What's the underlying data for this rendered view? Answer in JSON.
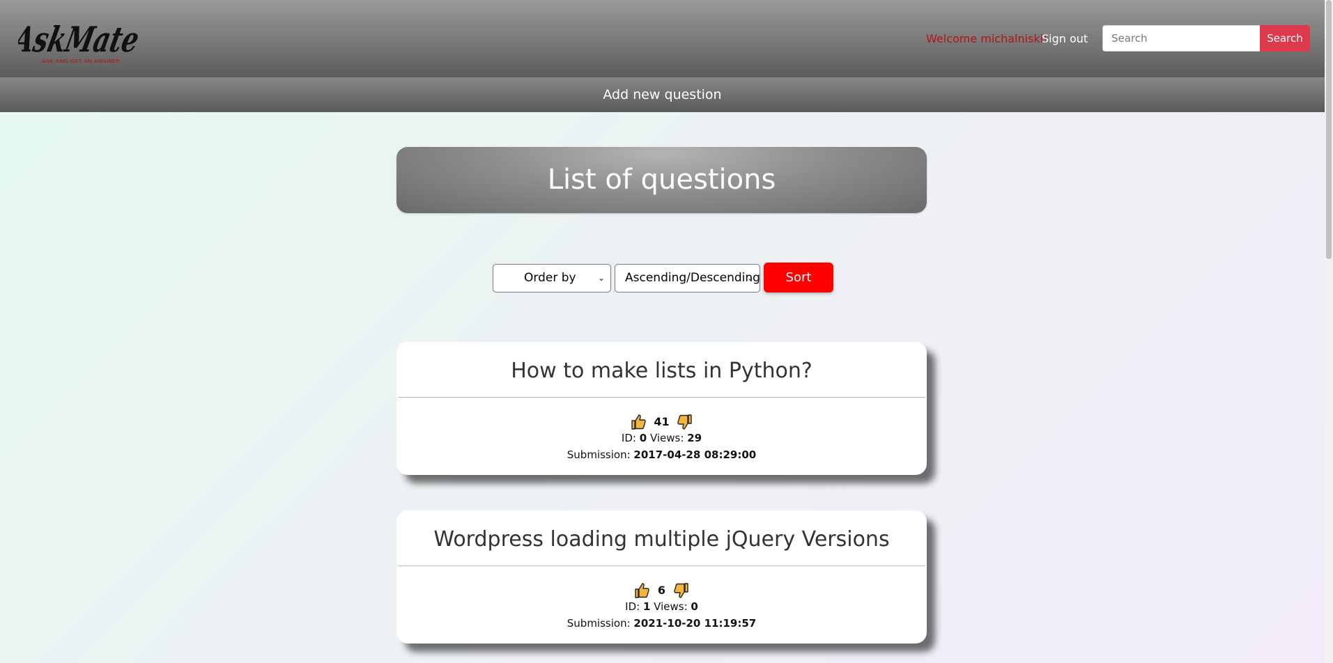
{
  "brand": {
    "logo_text": "AskMate",
    "logo_tagline": "ASK AND GET AN ANSWER"
  },
  "header": {
    "welcome_text": "Welcome michalniski!",
    "signout_label": "Sign out",
    "search_placeholder": "Search",
    "search_button_label": "Search"
  },
  "subnav": {
    "add_question_label": "Add new question"
  },
  "main": {
    "title": "List of questions",
    "sort": {
      "order_by_selected": "Order by",
      "direction_selected": "Ascending/Descending",
      "sort_button_label": "Sort"
    },
    "questions": [
      {
        "title": "How to make lists in Python?",
        "votes": "41",
        "id_label": "ID:",
        "id": "0",
        "views_label": "Views:",
        "views": "29",
        "submission_label": "Submission:",
        "submission": "2017-04-28 08:29:00"
      },
      {
        "title": "Wordpress loading multiple jQuery Versions",
        "votes": "6",
        "id_label": "ID:",
        "id": "1",
        "views_label": "Views:",
        "views": "0",
        "submission_label": "Submission:",
        "submission": "2021-10-20 11:19:57"
      }
    ]
  },
  "icons": {
    "upvote": "thumbs-up-icon",
    "downvote": "thumbs-down-icon",
    "dropdown": "chevron-down-icon"
  },
  "colors": {
    "navbar": "#6e6e6e",
    "welcome": "#b0151f",
    "search_button": "#de3a4d",
    "sort_button": "#fe0000",
    "thumb_fill": "#f5b53d",
    "card_bg": "#ffffff"
  }
}
